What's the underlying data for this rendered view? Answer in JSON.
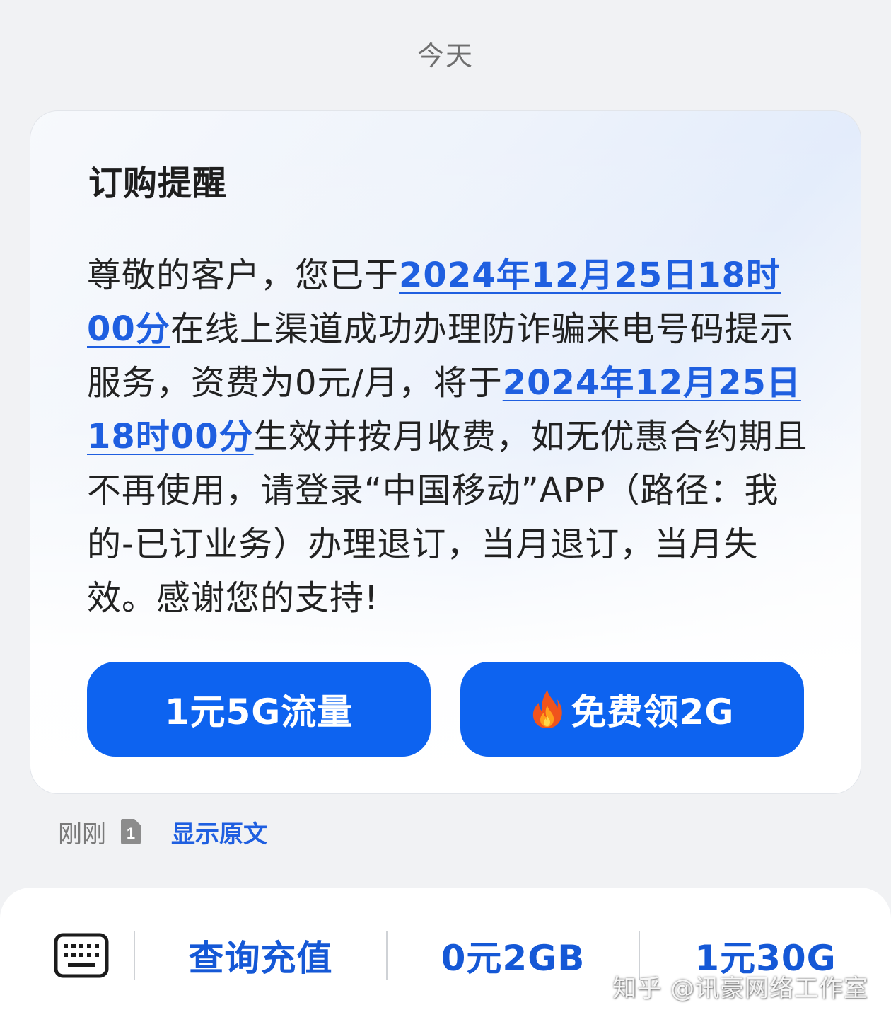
{
  "header": {
    "date_label": "今天"
  },
  "message": {
    "title": "订购提醒",
    "body": {
      "part1": "尊敬的客户，您已于",
      "date1": "2024年12月25日18时00分",
      "part2": "在线上渠道成功办理防诈骗来电号码提示服务，资费为0元/月，将于",
      "date2": "2024年12月25日18时00分",
      "part3": "生效并按月收费，如无优惠合约期且不再使用，请登录“中国移动”APP（路径：我的-已订业务）办理退订，当月退订，当月失效。感谢您的支持!"
    },
    "buttons": {
      "left_label": "1元5G流量",
      "right_label": "免费领2G",
      "right_icon": "fire-icon"
    },
    "meta": {
      "time": "刚刚",
      "sim_label": "1",
      "show_original": "显示原文"
    }
  },
  "bottom_menu": {
    "keyboard_icon": "keyboard-icon",
    "items": [
      {
        "label": "查询充值"
      },
      {
        "label": "0元2GB"
      },
      {
        "label": "1元30G"
      }
    ]
  },
  "watermark": {
    "text": "知乎 @讯豪网络工作室"
  },
  "colors": {
    "accent": "#0d63f0",
    "link": "#1f5fe0",
    "menu_text": "#1558d6",
    "background": "#f1f2f4"
  }
}
